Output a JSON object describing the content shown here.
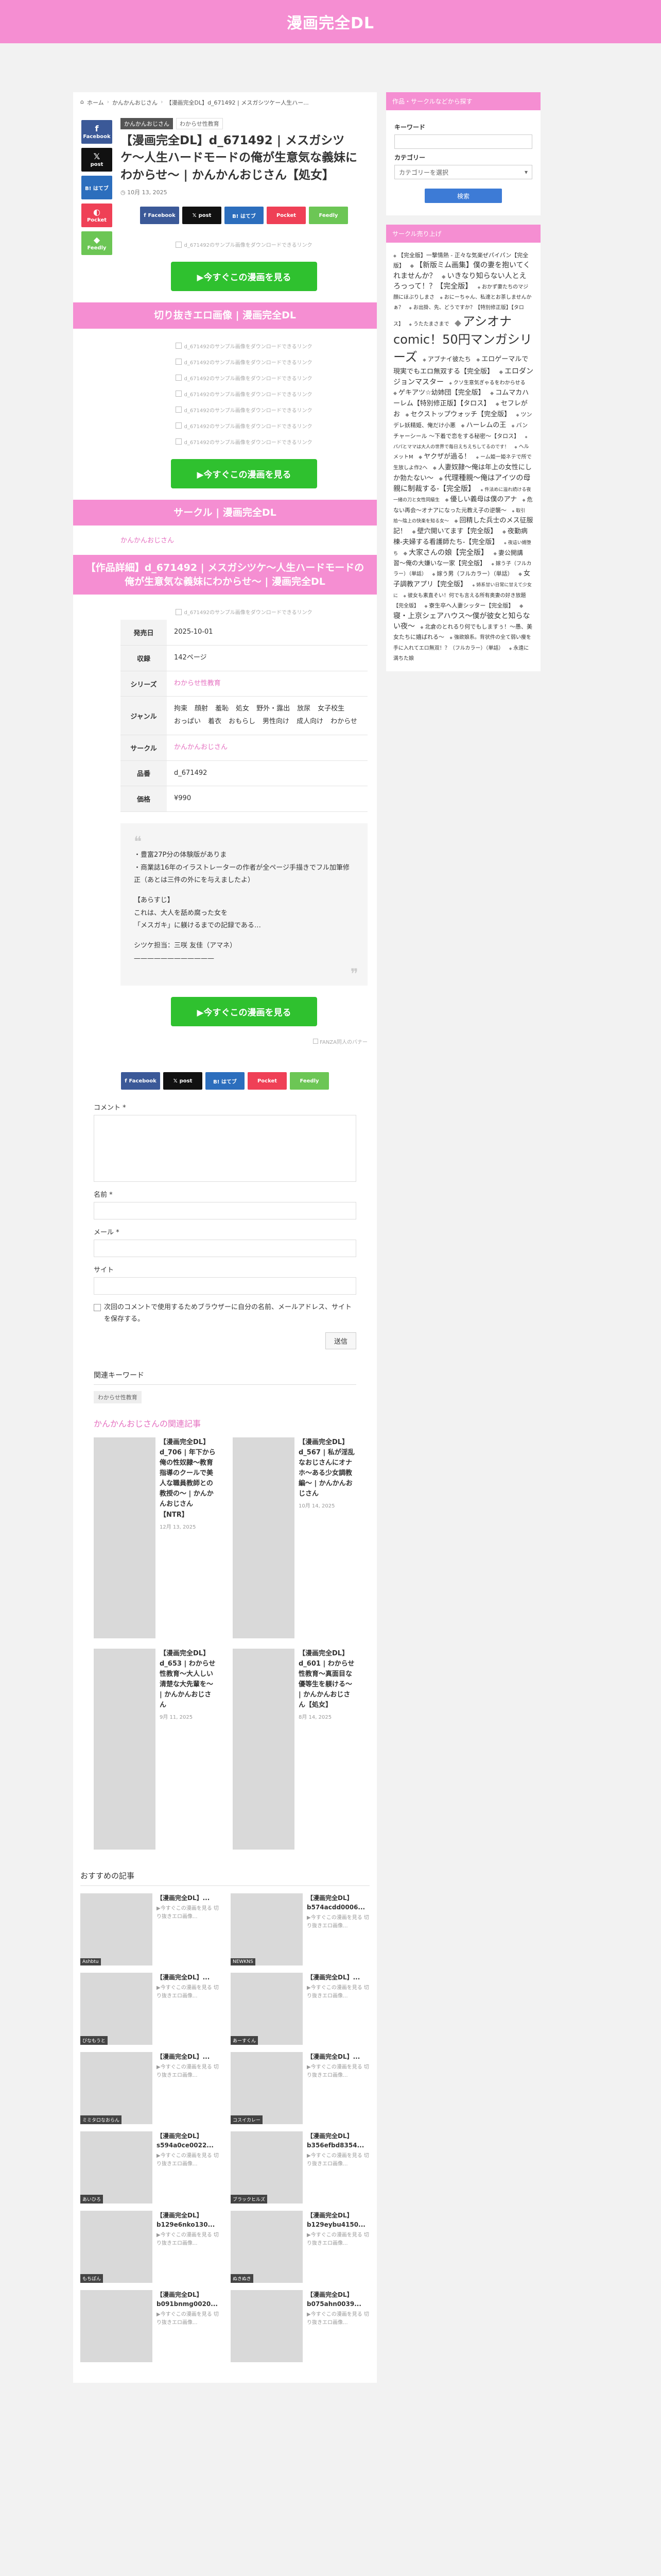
{
  "site": {
    "title": "漫画完全DL"
  },
  "breadcrumb": [
    "ホーム",
    "かんかんおじさん",
    "【漫画完全DL】d_671492 | メスガシツケー人生ハー..."
  ],
  "article": {
    "category": "かんかんおじさん",
    "tag": "わからせ性教育",
    "title": "【漫画完全DL】d_671492 | メスガシツケ〜人生ハードモードの俺が生意気な義妹にわからせ〜 | かんかんおじさん【処女】",
    "date": "10月 13, 2025"
  },
  "share": {
    "facebook": "Facebook",
    "x": "post",
    "hatena": "B! はてブ",
    "pocket": "Pocket",
    "feedly": "Feedly"
  },
  "placeholder": "d_671492のサンプル画像をダウンロードできるリンク",
  "cta": {
    "label": "▶今すぐこの漫画を見る"
  },
  "sections": {
    "sample": "切り抜きエロ画像 | 漫画完全DL",
    "circle": "サークル | 漫画完全DL",
    "detail": "【作品詳細】d_671492 | メスガシツケ〜人生ハードモードの俺が生意気な義妹にわからせ〜 | 漫画完全DL"
  },
  "circle_name": "かんかんおじさん",
  "info": {
    "release_label": "発売日",
    "release": "2025-10-01",
    "volume_label": "収録",
    "volume": "142ページ",
    "series_label": "シリーズ",
    "series": "わからせ性教育",
    "genre_label": "ジャンル",
    "genres": [
      "拘束",
      "顔射",
      "羞恥",
      "処女",
      "野外・露出",
      "放尿",
      "女子校生",
      "おっぱい",
      "着衣",
      "おもらし",
      "男性向け",
      "成人向け",
      "わからせ"
    ],
    "circle_label": "サークル",
    "circle": "かんかんおじさん",
    "code_label": "品番",
    "code": "d_671492",
    "price_label": "価格",
    "price": "¥990"
  },
  "description": {
    "p1": "・豊富27P分の体験版がありま\n・商業誌16年のイラストレーターの作者が全ページ手描きでフル加筆修正（あとは三件の外にを与えましたよ）",
    "p2": "【あらすじ】\nこれは、大人を舐め腐った女を\n「メスガキ」に躾けるまでの記録である…",
    "p3": "シツケ担当：三咲 友佳（アマネ）\n————————————"
  },
  "fanza_banner": "FANZA同人のバナー",
  "comment": {
    "comment_label": "コメント *",
    "name_label": "名前 *",
    "email_label": "メール *",
    "site_label": "サイト",
    "cookie_text": "次回のコメントで使用するためブラウザーに自分の名前、メールアドレス、サイトを保存する。",
    "submit": "送信"
  },
  "keywords": {
    "title": "関連キーワード",
    "chip": "わからせ性教育"
  },
  "related": {
    "title": "かんかんおじさんの関連記事",
    "items": [
      {
        "text": "【漫画完全DL】d_706 | 年下から俺の性奴隷〜教育指導のクールで美人な職員教師との教授の〜 | かんかんおじさん【NTR】",
        "date": "12月 13, 2025"
      },
      {
        "text": "【漫画完全DL】d_567 | 私が淫乱なおじさんにオナホ〜ある少女調教編〜 | かんかんおじさん",
        "date": "10月 14, 2025"
      },
      {
        "text": "【漫画完全DL】d_653 | わからせ性教育〜大人しい清楚な大先輩を〜 | かんかんおじさん",
        "date": "9月 11, 2025"
      },
      {
        "text": "【漫画完全DL】d_601 | わからせ性教育〜真面目な優等生を躾ける〜 | かんかんおじさん【処女】",
        "date": "8月 14, 2025"
      }
    ]
  },
  "recommended": {
    "title": "おすすめの記事",
    "items": [
      {
        "title": "【漫画完全DL】...",
        "desc": "▶今すぐこの漫画を見る 切り抜きエロ画像...",
        "badge": "Ashbtu"
      },
      {
        "title": "【漫画完全DL】b574acdd0006...",
        "desc": "▶今すぐこの漫画を見る 切り抜きエロ画像...",
        "badge": "NEWKNS"
      },
      {
        "title": "【漫画完全DL】...",
        "desc": "▶今すぐこの漫画を見る 切り抜きエロ画像...",
        "badge": "びなもうと"
      },
      {
        "title": "【漫画完全DL】...",
        "desc": "▶今すぐこの漫画を見る 切り抜きエロ画像...",
        "badge": "あーすくん"
      },
      {
        "title": "【漫画完全DL】...",
        "desc": "▶今すぐこの漫画を見る 切り抜きエロ画像...",
        "badge": "ミミタロなおらん"
      },
      {
        "title": "【漫画完全DL】...",
        "desc": "▶今すぐこの漫画を見る 切り抜きエロ画像...",
        "badge": "コスイカレー"
      },
      {
        "title": "【漫画完全DL】s594a0ce0022...",
        "desc": "▶今すぐこの漫画を見る 切り抜きエロ画像...",
        "badge": "あいひろ"
      },
      {
        "title": "【漫画完全DL】b356efbd8354...",
        "desc": "▶今すぐこの漫画を見る 切り抜きエロ画像...",
        "badge": "ブラックヒルズ"
      },
      {
        "title": "【漫画完全DL】b129e6nko130...",
        "desc": "▶今すぐこの漫画を見る 切り抜きエロ画像...",
        "badge": "もちぽん"
      },
      {
        "title": "【漫画完全DL】b129eybu4150...",
        "desc": "▶今すぐこの漫画を見る 切り抜きエロ画像...",
        "badge": "ぬきぬき"
      },
      {
        "title": "【漫画完全DL】b091bnmg0020...",
        "desc": "▶今すぐこの漫画を見る 切り抜きエロ画像...",
        "badge": ""
      },
      {
        "title": "【漫画完全DL】b075ahn0039...",
        "desc": "▶今すぐこの漫画を見る 切り抜きエロ画像...",
        "badge": ""
      }
    ]
  },
  "sidebar": {
    "search_title": "作品・サークルなどから探す",
    "keyword_label": "キーワード",
    "category_label": "カテゴリー",
    "category_select": "カテゴリーを選択",
    "search_button": "検索",
    "ranking_title": "サークル売り上げ",
    "tags": [
      {
        "label": "【完全版】一撃情熱 - 正々な気楽ぜパイパン【完全版】",
        "size": 11
      },
      {
        "label": "【新版ミム画集】僕の妻を抱いてくれませんか？",
        "size": 14
      },
      {
        "label": "いきなり知らない人とえろっって！？【完全版】",
        "size": 14
      },
      {
        "label": "おかず妻たちのマジ顔にほぶりしまさ",
        "size": 10
      },
      {
        "label": "おにーちゃん、私達とお茶しませんかぁ？",
        "size": 10
      },
      {
        "label": "お出掛、先、どうですか？【特別修正版】【タロス】",
        "size": 10
      },
      {
        "label": "うたたまさまで",
        "size": 10
      },
      {
        "label": "アシオナcomic！50円マンガシリーズ",
        "size": 24
      },
      {
        "label": "アブナイ彼たち",
        "size": 12
      },
      {
        "label": "エロゲーマルで現実でもエロ無双する【完全版】",
        "size": 13
      },
      {
        "label": "エロダンジョンマスター",
        "size": 14
      },
      {
        "label": "クソ生意気ぎゃるをわからせる",
        "size": 10
      },
      {
        "label": "ゲキアツ☆幼姉団【完全版】",
        "size": 13
      },
      {
        "label": "コムマカハーレム【特別修正版】【タロス】",
        "size": 13
      },
      {
        "label": "セフレがお",
        "size": 13
      },
      {
        "label": "セクストップウォッチ【完全版】",
        "size": 13
      },
      {
        "label": "ツンデレ妖精姫、俺だけ小悪",
        "size": 11
      },
      {
        "label": "ハーレムの王",
        "size": 13
      },
      {
        "label": "バンチャーシール ～下着で恋をする秘密～【タロス】",
        "size": 11
      },
      {
        "label": "パパとママは大人の世界で毎日えちえちしてるのです！",
        "size": 9
      },
      {
        "label": "ヘルメットM",
        "size": 10
      },
      {
        "label": "ヤクザが過る！",
        "size": 13
      },
      {
        "label": "ーム姫ー姫ネテで所で生放しよ作2へ",
        "size": 10
      },
      {
        "label": "人妻奴隷〜俺は年上の女性にしか勃たない〜",
        "size": 13
      },
      {
        "label": "代理種親〜俺はアイツの母親に制裁する-【完全版】",
        "size": 14
      },
      {
        "label": "件法めに溢れ続ける夜 一緒の刀と女性同級生",
        "size": 9
      },
      {
        "label": "優しい義母は僕のアナ",
        "size": 13
      },
      {
        "label": "危ない再会〜オナアになった元教え子の逆襲〜",
        "size": 11
      },
      {
        "label": "取引拾〜陰上の快楽を知る女〜",
        "size": 9
      },
      {
        "label": "回精した兵士のメス征服記！",
        "size": 13
      },
      {
        "label": "壁穴開いてます【完全版】",
        "size": 13
      },
      {
        "label": "夜勤病棟-夫婦する看護師たち-【完全版】",
        "size": 13
      },
      {
        "label": "夜這い婿堕ち",
        "size": 9
      },
      {
        "label": "大家さんの娘【完全版】",
        "size": 14
      },
      {
        "label": "妻公開講習〜俺の大嫌いな一家【完全版】",
        "size": 12
      },
      {
        "label": "嫁う子（フルカラー）（単話）",
        "size": 10
      },
      {
        "label": "嫁う男（フルカラー）（単話）",
        "size": 11
      },
      {
        "label": "女子調教アプリ【完全版】",
        "size": 13
      },
      {
        "label": "姉系甘い日常に甘えて少女に",
        "size": 9
      },
      {
        "label": "彼女も素直そい！何でも言える所有奥妻の好き放題【完全版】",
        "size": 10
      },
      {
        "label": "寮生卒へ人妻シッター【完全版】",
        "size": 11
      },
      {
        "label": "寝・上京シェアハウス〜僕が彼女と知らない夜〜",
        "size": 14
      },
      {
        "label": "北倉のとれるり何でもしますぅ！〜愚、美女たちに嬉ばれる〜",
        "size": 11
      },
      {
        "label": "強欲娘系。背状件の全て弱い痩を手に入れてエロ無双！？（フルカラー）（単話）",
        "size": 10
      },
      {
        "label": "永遠に満ちた娘",
        "size": 10
      }
    ]
  },
  "colors": {
    "brand": "#f58ed2",
    "cta": "#2fc12f",
    "facebook": "#3b5998",
    "x": "#111111",
    "hatena": "#2c6ebd",
    "pocket": "#ef4056",
    "feedly": "#6cc655"
  }
}
